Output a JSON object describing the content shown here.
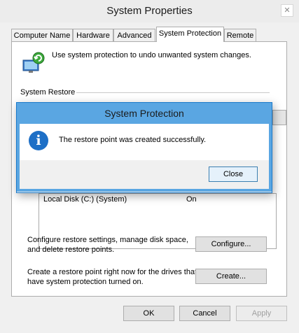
{
  "window": {
    "title": "System Properties",
    "close_glyph": "✕"
  },
  "tabs": [
    {
      "label": "Computer Name"
    },
    {
      "label": "Hardware"
    },
    {
      "label": "Advanced"
    },
    {
      "label": "System Protection"
    },
    {
      "label": "Remote"
    }
  ],
  "active_tab": "System Protection",
  "panel": {
    "intro": "Use system protection to undo unwanted system changes.",
    "system_restore_label": "System Restore",
    "drive": {
      "name": "Local Disk (C:) (System)",
      "status": "On"
    },
    "configure_text_1": "Configure restore settings, manage disk space,",
    "configure_text_2": "and delete restore points.",
    "configure_button": "Configure...",
    "create_text_1": "Create a restore point right now for the drives that",
    "create_text_2": "have system protection turned on.",
    "create_button": "Create..."
  },
  "footer": {
    "ok": "OK",
    "cancel": "Cancel",
    "apply": "Apply"
  },
  "dialog": {
    "title": "System Protection",
    "icon": "info-icon",
    "icon_glyph": "i",
    "message": "The restore point was created successfully.",
    "close_button": "Close"
  },
  "colors": {
    "dialog_border": "#5aa6e2",
    "info_blue": "#1d6fc6"
  }
}
